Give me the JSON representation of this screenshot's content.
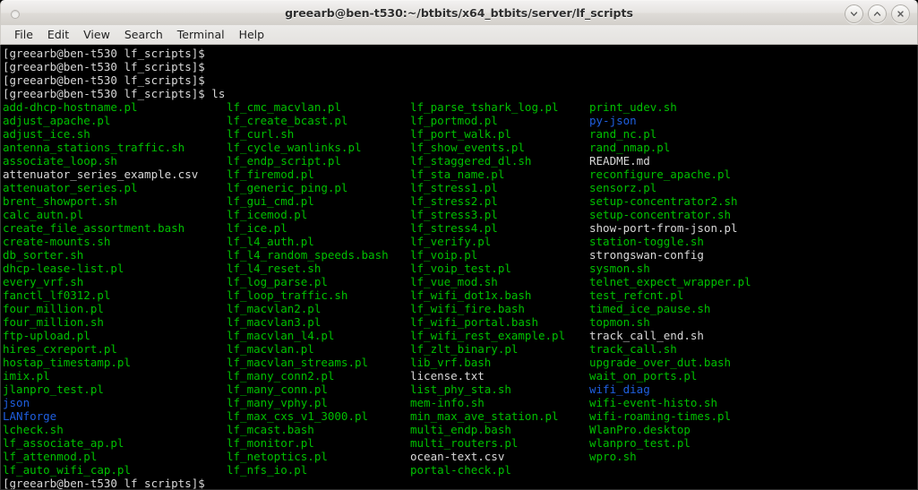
{
  "window": {
    "title": "greearb@ben-t530:~/btbits/x64_btbits/server/lf_scripts",
    "buttons": {
      "minimize": "v",
      "maximize": "^",
      "close": "x"
    }
  },
  "menubar": {
    "items": [
      {
        "label": "File"
      },
      {
        "label": "Edit"
      },
      {
        "label": "View"
      },
      {
        "label": "Search"
      },
      {
        "label": "Terminal"
      },
      {
        "label": "Help"
      }
    ]
  },
  "terminal": {
    "prompt": "[greearb@ben-t530 lf_scripts]$",
    "command": "ls",
    "colors": {
      "background": "#000000",
      "foreground": "#d8d8d8",
      "executable": "#00c000",
      "directory": "#1f5fe0",
      "regular_file": "#d8d8d8"
    },
    "prompt_lines": [
      "[greearb@ben-t530 lf_scripts]$",
      "[greearb@ben-t530 lf_scripts]$",
      "[greearb@ben-t530 lf_scripts]$"
    ],
    "command_line": "[greearb@ben-t530 lf_scripts]$ ls",
    "final_prompt": "[greearb@ben-t530 lf_scripts]$",
    "listing_rows": [
      [
        {
          "name": "add-dhcp-hostname.pl",
          "type": "exe"
        },
        {
          "name": "lf_cmc_macvlan.pl",
          "type": "exe"
        },
        {
          "name": "lf_parse_tshark_log.pl",
          "type": "exe"
        },
        {
          "name": "print_udev.sh",
          "type": "exe"
        }
      ],
      [
        {
          "name": "adjust_apache.pl",
          "type": "exe"
        },
        {
          "name": "lf_create_bcast.pl",
          "type": "exe"
        },
        {
          "name": "lf_portmod.pl",
          "type": "exe"
        },
        {
          "name": "py-json",
          "type": "dir"
        }
      ],
      [
        {
          "name": "adjust_ice.sh",
          "type": "exe"
        },
        {
          "name": "lf_curl.sh",
          "type": "exe"
        },
        {
          "name": "lf_port_walk.pl",
          "type": "exe"
        },
        {
          "name": "rand_nc.pl",
          "type": "exe"
        }
      ],
      [
        {
          "name": "antenna_stations_traffic.sh",
          "type": "exe"
        },
        {
          "name": "lf_cycle_wanlinks.pl",
          "type": "exe"
        },
        {
          "name": "lf_show_events.pl",
          "type": "exe"
        },
        {
          "name": "rand_nmap.pl",
          "type": "exe"
        }
      ],
      [
        {
          "name": "associate_loop.sh",
          "type": "exe"
        },
        {
          "name": "lf_endp_script.pl",
          "type": "exe"
        },
        {
          "name": "lf_staggered_dl.sh",
          "type": "exe"
        },
        {
          "name": "README.md",
          "type": "file"
        }
      ],
      [
        {
          "name": "attenuator_series_example.csv",
          "type": "file"
        },
        {
          "name": "lf_firemod.pl",
          "type": "exe"
        },
        {
          "name": "lf_sta_name.pl",
          "type": "exe"
        },
        {
          "name": "reconfigure_apache.pl",
          "type": "exe"
        }
      ],
      [
        {
          "name": "attenuator_series.pl",
          "type": "exe"
        },
        {
          "name": "lf_generic_ping.pl",
          "type": "exe"
        },
        {
          "name": "lf_stress1.pl",
          "type": "exe"
        },
        {
          "name": "sensorz.pl",
          "type": "exe"
        }
      ],
      [
        {
          "name": "brent_showport.sh",
          "type": "exe"
        },
        {
          "name": "lf_gui_cmd.pl",
          "type": "exe"
        },
        {
          "name": "lf_stress2.pl",
          "type": "exe"
        },
        {
          "name": "setup-concentrator2.sh",
          "type": "exe"
        }
      ],
      [
        {
          "name": "calc_autn.pl",
          "type": "exe"
        },
        {
          "name": "lf_icemod.pl",
          "type": "exe"
        },
        {
          "name": "lf_stress3.pl",
          "type": "exe"
        },
        {
          "name": "setup-concentrator.sh",
          "type": "exe"
        }
      ],
      [
        {
          "name": "create_file_assortment.bash",
          "type": "exe"
        },
        {
          "name": "lf_ice.pl",
          "type": "exe"
        },
        {
          "name": "lf_stress4.pl",
          "type": "exe"
        },
        {
          "name": "show-port-from-json.pl",
          "type": "file"
        }
      ],
      [
        {
          "name": "create-mounts.sh",
          "type": "exe"
        },
        {
          "name": "lf_l4_auth.pl",
          "type": "exe"
        },
        {
          "name": "lf_verify.pl",
          "type": "exe"
        },
        {
          "name": "station-toggle.sh",
          "type": "exe"
        }
      ],
      [
        {
          "name": "db_sorter.sh",
          "type": "exe"
        },
        {
          "name": "lf_l4_random_speeds.bash",
          "type": "exe"
        },
        {
          "name": "lf_voip.pl",
          "type": "exe"
        },
        {
          "name": "strongswan-config",
          "type": "file"
        }
      ],
      [
        {
          "name": "dhcp-lease-list.pl",
          "type": "exe"
        },
        {
          "name": "lf_l4_reset.sh",
          "type": "exe"
        },
        {
          "name": "lf_voip_test.pl",
          "type": "exe"
        },
        {
          "name": "sysmon.sh",
          "type": "exe"
        }
      ],
      [
        {
          "name": "every_vrf.sh",
          "type": "exe"
        },
        {
          "name": "lf_log_parse.pl",
          "type": "exe"
        },
        {
          "name": "lf_vue_mod.sh",
          "type": "exe"
        },
        {
          "name": "telnet_expect_wrapper.pl",
          "type": "exe"
        }
      ],
      [
        {
          "name": "fanctl_lf0312.pl",
          "type": "exe"
        },
        {
          "name": "lf_loop_traffic.sh",
          "type": "exe"
        },
        {
          "name": "lf_wifi_dot1x.bash",
          "type": "exe"
        },
        {
          "name": "test_refcnt.pl",
          "type": "exe"
        }
      ],
      [
        {
          "name": "four_million.pl",
          "type": "exe"
        },
        {
          "name": "lf_macvlan2.pl",
          "type": "exe"
        },
        {
          "name": "lf_wifi_fire.bash",
          "type": "exe"
        },
        {
          "name": "timed_ice_pause.sh",
          "type": "exe"
        }
      ],
      [
        {
          "name": "four_million.sh",
          "type": "exe"
        },
        {
          "name": "lf_macvlan3.pl",
          "type": "exe"
        },
        {
          "name": "lf_wifi_portal.bash",
          "type": "exe"
        },
        {
          "name": "topmon.sh",
          "type": "exe"
        }
      ],
      [
        {
          "name": "ftp-upload.pl",
          "type": "exe"
        },
        {
          "name": "lf_macvlan_l4.pl",
          "type": "exe"
        },
        {
          "name": "lf_wifi_rest_example.pl",
          "type": "exe"
        },
        {
          "name": "track_call_end.sh",
          "type": "file"
        }
      ],
      [
        {
          "name": "hires_cxreport.pl",
          "type": "exe"
        },
        {
          "name": "lf_macvlan.pl",
          "type": "exe"
        },
        {
          "name": "lf_zlt_binary.pl",
          "type": "exe"
        },
        {
          "name": "track_call.sh",
          "type": "exe"
        }
      ],
      [
        {
          "name": "hostap_timestamp.pl",
          "type": "exe"
        },
        {
          "name": "lf_macvlan_streams.pl",
          "type": "exe"
        },
        {
          "name": "lib_vrf.bash",
          "type": "exe"
        },
        {
          "name": "upgrade_over_dut.bash",
          "type": "exe"
        }
      ],
      [
        {
          "name": "imix.pl",
          "type": "exe"
        },
        {
          "name": "lf_many_conn2.pl",
          "type": "exe"
        },
        {
          "name": "license.txt",
          "type": "file"
        },
        {
          "name": "wait_on_ports.pl",
          "type": "exe"
        }
      ],
      [
        {
          "name": "jlanpro_test.pl",
          "type": "exe"
        },
        {
          "name": "lf_many_conn.pl",
          "type": "exe"
        },
        {
          "name": "list_phy_sta.sh",
          "type": "exe"
        },
        {
          "name": "wifi_diag",
          "type": "dir"
        }
      ],
      [
        {
          "name": "json",
          "type": "dir"
        },
        {
          "name": "lf_many_vphy.pl",
          "type": "exe"
        },
        {
          "name": "mem-info.sh",
          "type": "exe"
        },
        {
          "name": "wifi-event-histo.sh",
          "type": "exe"
        }
      ],
      [
        {
          "name": "LANforge",
          "type": "dir"
        },
        {
          "name": "lf_max_cxs_v1_3000.pl",
          "type": "exe"
        },
        {
          "name": "min_max_ave_station.pl",
          "type": "exe"
        },
        {
          "name": "wifi-roaming-times.pl",
          "type": "exe"
        }
      ],
      [
        {
          "name": "lcheck.sh",
          "type": "exe"
        },
        {
          "name": "lf_mcast.bash",
          "type": "exe"
        },
        {
          "name": "multi_endp.bash",
          "type": "exe"
        },
        {
          "name": "WlanPro.desktop",
          "type": "exe"
        }
      ],
      [
        {
          "name": "lf_associate_ap.pl",
          "type": "exe"
        },
        {
          "name": "lf_monitor.pl",
          "type": "exe"
        },
        {
          "name": "multi_routers.pl",
          "type": "exe"
        },
        {
          "name": "wlanpro_test.pl",
          "type": "exe"
        }
      ],
      [
        {
          "name": "lf_attenmod.pl",
          "type": "exe"
        },
        {
          "name": "lf_netoptics.pl",
          "type": "exe"
        },
        {
          "name": "ocean-text.csv",
          "type": "file"
        },
        {
          "name": "wpro.sh",
          "type": "exe"
        }
      ],
      [
        {
          "name": "lf_auto_wifi_cap.pl",
          "type": "exe"
        },
        {
          "name": "lf_nfs_io.pl",
          "type": "exe"
        },
        {
          "name": "portal-check.pl",
          "type": "exe"
        },
        {
          "name": "",
          "type": "exe"
        }
      ]
    ]
  }
}
